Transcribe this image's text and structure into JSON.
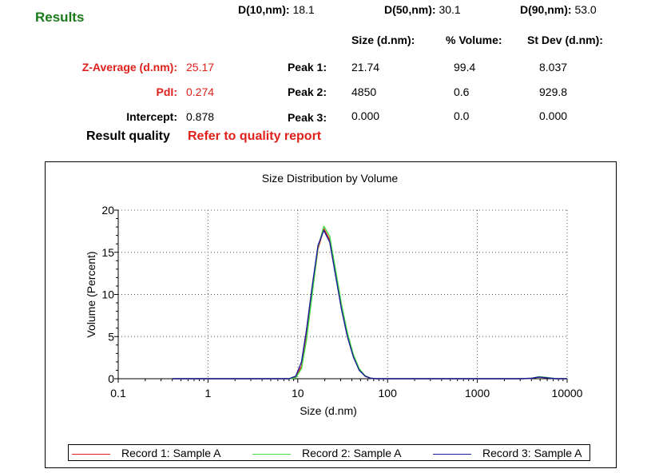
{
  "results": {
    "title": "Results",
    "d10": {
      "label": "D(10,nm):",
      "value": "18.1"
    },
    "d50": {
      "label": "D(50,nm):",
      "value": "30.1"
    },
    "d90": {
      "label": "D(90,nm):",
      "value": "53.0"
    },
    "columns": {
      "size": "Size (d.nm):",
      "volume": "% Volume:",
      "stdev": "St Dev (d.nm):"
    },
    "z_average": {
      "label": "Z-Average (d.nm):",
      "value": "25.17"
    },
    "pdi": {
      "label": "PdI:",
      "value": "0.274"
    },
    "intercept": {
      "label": "Intercept:",
      "value": "0.878"
    },
    "peaks": [
      {
        "label": "Peak 1:",
        "size": "21.74",
        "volume": "99.4",
        "stdev": "8.037"
      },
      {
        "label": "Peak 2:",
        "size": "4850",
        "volume": "0.6",
        "stdev": "929.8"
      },
      {
        "label": "Peak 3:",
        "size": "0.000",
        "volume": "0.0",
        "stdev": "0.000"
      }
    ],
    "quality_label": "Result quality",
    "quality_value": "Refer to quality report"
  },
  "colors": {
    "accent_green": "#1a7a1a",
    "alert_red": "#e0201b"
  },
  "chart_data": {
    "type": "line",
    "title": "Size Distribution by Volume",
    "xlabel": "Size (d.nm)",
    "ylabel": "Volume (Percent)",
    "x_scale": "log",
    "xlim": [
      0.1,
      10000
    ],
    "ylim": [
      0,
      20
    ],
    "x_ticks": [
      0.1,
      1,
      10,
      100,
      1000,
      10000
    ],
    "x_tick_labels": [
      "0.1",
      "1",
      "10",
      "100",
      "1000",
      "10000"
    ],
    "y_ticks": [
      0,
      5,
      10,
      15,
      20
    ],
    "y_tick_labels": [
      "0",
      "5",
      "10",
      "15",
      "20"
    ],
    "grid": true,
    "legend_position": "bottom",
    "series": [
      {
        "name": "Record 1: Sample A",
        "color": "#e0201b",
        "x": [
          0.4,
          1,
          3,
          8,
          9.5,
          11,
          12.5,
          14.5,
          16.8,
          19.5,
          22.7,
          26.4,
          30.7,
          35.7,
          41.5,
          48.3,
          56.2,
          65.3,
          76,
          100,
          1000,
          3000,
          4000,
          4850,
          6000,
          7500,
          10000
        ],
        "y": [
          0,
          0,
          0,
          0,
          0.2,
          1.5,
          5.0,
          10.2,
          15.4,
          17.8,
          16.5,
          12.5,
          8.5,
          5.3,
          2.8,
          1.1,
          0.3,
          0.05,
          0,
          0,
          0,
          0,
          0.05,
          0.2,
          0.1,
          0,
          0
        ]
      },
      {
        "name": "Record 2: Sample A",
        "color": "#44dd44",
        "x": [
          0.4,
          1,
          3,
          8,
          9.5,
          11,
          12.5,
          14.5,
          16.8,
          19.5,
          22.7,
          26.4,
          30.7,
          35.7,
          41.5,
          48.3,
          56.2,
          65.3,
          76,
          100,
          1000,
          3000,
          4000,
          4850,
          6000,
          7500,
          10000
        ],
        "y": [
          0,
          0,
          0,
          0,
          0.1,
          1.2,
          4.6,
          10.0,
          15.6,
          18.1,
          16.9,
          12.9,
          8.8,
          5.5,
          2.9,
          1.2,
          0.35,
          0.05,
          0,
          0,
          0,
          0,
          0.05,
          0.25,
          0.15,
          0,
          0
        ]
      },
      {
        "name": "Record 3: Sample A",
        "color": "#1b1b9a",
        "x": [
          0.4,
          1,
          3,
          8,
          9.5,
          11,
          12.5,
          14.5,
          16.8,
          19.5,
          22.7,
          26.4,
          30.7,
          35.7,
          41.5,
          48.3,
          56.2,
          65.3,
          76,
          100,
          1000,
          3000,
          4000,
          4850,
          6000,
          7500,
          10000
        ],
        "y": [
          0,
          0,
          0,
          0,
          0.3,
          2.0,
          5.8,
          11.0,
          15.8,
          17.6,
          16.2,
          12.2,
          8.2,
          5.0,
          2.6,
          1.0,
          0.3,
          0.05,
          0,
          0,
          0,
          0,
          0.05,
          0.2,
          0.1,
          0,
          0
        ]
      }
    ]
  }
}
